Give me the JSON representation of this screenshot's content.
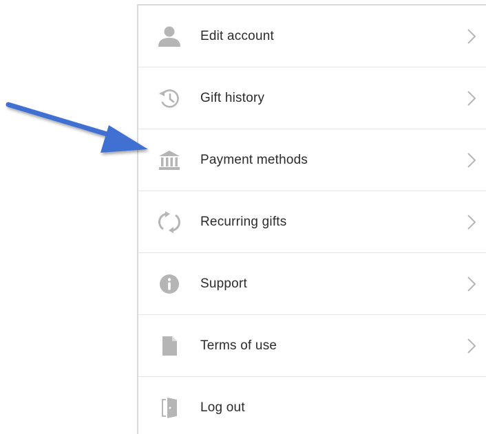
{
  "menu": {
    "items": [
      {
        "label": "Edit account",
        "icon": "person-icon",
        "chevron": true
      },
      {
        "label": "Gift history",
        "icon": "history-icon",
        "chevron": true
      },
      {
        "label": "Payment methods",
        "icon": "bank-icon",
        "chevron": true
      },
      {
        "label": "Recurring gifts",
        "icon": "refresh-icon",
        "chevron": true
      },
      {
        "label": "Support",
        "icon": "info-icon",
        "chevron": true
      },
      {
        "label": "Terms of use",
        "icon": "document-icon",
        "chevron": true
      },
      {
        "label": "Log out",
        "icon": "door-icon",
        "chevron": false
      }
    ]
  },
  "colors": {
    "icon": "#b5b5b5",
    "chevron": "#b5b5b5",
    "text": "#2b2b2b",
    "annotation_arrow": "#3f6fd1"
  }
}
